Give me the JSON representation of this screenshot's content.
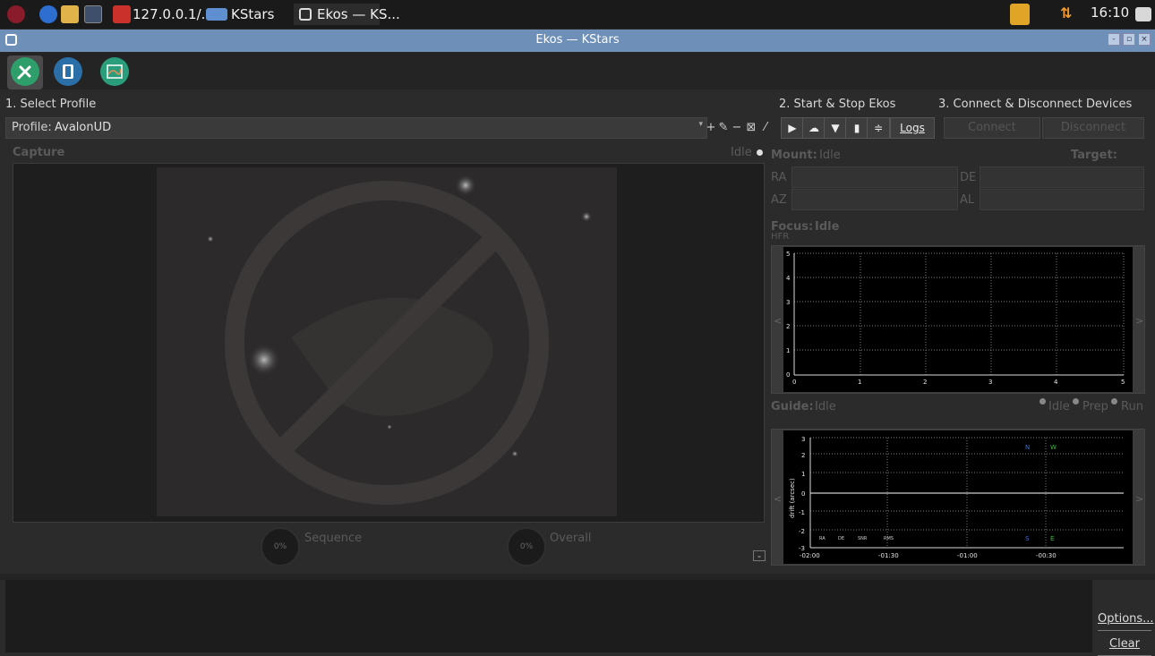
{
  "taskbar": {
    "tasks": [
      {
        "label": "127.0.0.1/..."
      },
      {
        "label": "KStars"
      },
      {
        "label": "Ekos — KS..."
      }
    ],
    "clock": "16:10"
  },
  "window": {
    "title": "Ekos — KStars"
  },
  "toolbar": {
    "tabs": [
      {
        "name": "setup",
        "icon": "wrench-screwdriver-icon",
        "color": "#2e9e6a"
      },
      {
        "name": "capture",
        "icon": "camera-icon",
        "color": "#2a6fa8"
      },
      {
        "name": "analyze",
        "icon": "chart-icon",
        "color": "#2a9e7a"
      }
    ]
  },
  "profile": {
    "section_title": "1. Select Profile",
    "label": "Profile:",
    "value": "AvalonUD",
    "add": "+",
    "edit": "✎",
    "remove": "−",
    "wizard": "⊠",
    "custom": "⁄"
  },
  "ekos_control": {
    "section_title": "2. Start & Stop Ekos",
    "start": "▶",
    "indi_control": "☁",
    "logs": "Logs"
  },
  "devices": {
    "section_title": "3. Connect & Disconnect Devices",
    "connect": "Connect",
    "disconnect": "Disconnect"
  },
  "capture": {
    "title": "Capture",
    "status": "Idle",
    "sequence_label": "Sequence",
    "sequence_percent": "0%",
    "sequence_progress": 0,
    "overall_label": "Overall",
    "overall_percent": "0%",
    "overall_progress": 0
  },
  "mount": {
    "title": "Mount:",
    "status": "Idle",
    "target_label": "Target:",
    "ra_label": "RA",
    "de_label": "DE",
    "az_label": "AZ",
    "al_label": "AL"
  },
  "focus": {
    "title": "Focus:",
    "status": "Idle",
    "hfr_label": "HFR",
    "x_ticks": [
      "0",
      "1",
      "2",
      "3",
      "4",
      "5"
    ],
    "y_ticks": [
      "0",
      "1",
      "2",
      "3",
      "4",
      "5"
    ]
  },
  "guide": {
    "title": "Guide:",
    "status": "Idle",
    "states": [
      "Idle",
      "Prep",
      "Run"
    ],
    "ylabel": "drift (arcsec)",
    "x_ticks": [
      "-02:00",
      "-01:30",
      "-01:00",
      "-00:30"
    ],
    "y_ticks": [
      "3",
      "2",
      "1",
      "0",
      "-1",
      "-2",
      "-3"
    ],
    "legend": [
      "RA",
      "DE",
      "SNR",
      "RMS"
    ],
    "compass": {
      "n": "N",
      "w": "W",
      "s": "S",
      "e": "E"
    }
  },
  "log": {
    "options": "Options...",
    "clear": "Clear"
  },
  "colors": {
    "titlebar": "#6e8fb8",
    "north": "#3b6fd6",
    "west": "#3bbd3b"
  }
}
